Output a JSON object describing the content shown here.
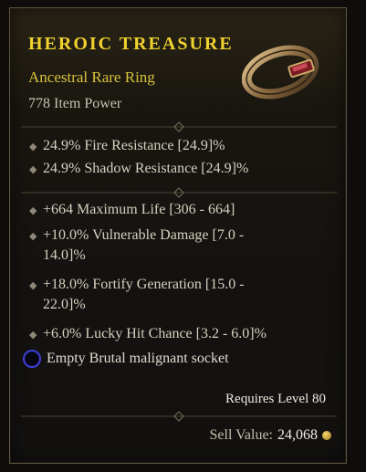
{
  "item": {
    "name": "HEROIC TREASURE",
    "type": "Ancestral Rare Ring",
    "power": "778 Item Power"
  },
  "implicits": [
    "24.9% Fire Resistance [24.9]%",
    "24.9% Shadow Resistance [24.9]%"
  ],
  "affixes": [
    [
      "+664 Maximum Life [306 - 664]"
    ],
    [
      "+10.0% Vulnerable Damage [7.0 -",
      "14.0]%"
    ],
    [
      "+18.0% Fortify Generation [15.0 -",
      "22.0]%"
    ],
    [
      "+6.0% Lucky Hit Chance [3.2 - 6.0]%"
    ]
  ],
  "socket": {
    "label": "Empty Brutal malignant socket"
  },
  "requires": "Requires Level 80",
  "sell": {
    "label": "Sell Value:",
    "value": "24,068"
  },
  "colors": {
    "rare_name": "#f1d22e",
    "rare_type": "#d9c23a",
    "socket_ring": "#3d3fd6"
  },
  "icons": [
    "ring-icon",
    "diamond-bullet-icon",
    "malignant-socket-icon",
    "gold-coin-icon"
  ]
}
